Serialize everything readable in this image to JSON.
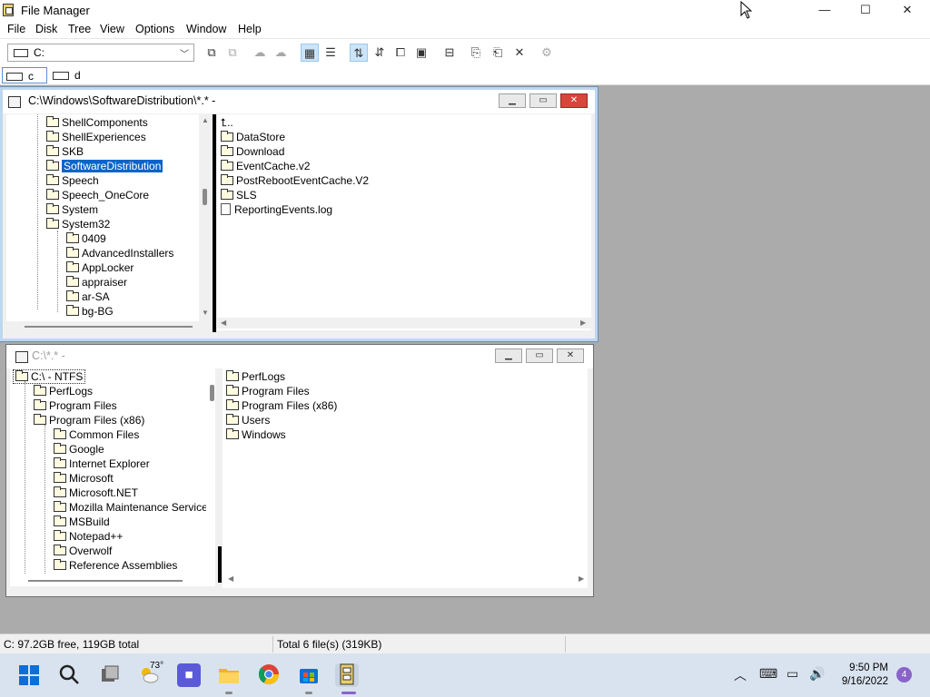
{
  "app": {
    "title": "File Manager",
    "controls": {
      "minimize": "—",
      "maximize": "☐",
      "close": "✕"
    }
  },
  "menu": [
    "File",
    "Disk",
    "Tree",
    "View",
    "Options",
    "Window",
    "Help"
  ],
  "toolbar": {
    "drive_selector": {
      "value": "C:"
    }
  },
  "drives": [
    {
      "label": "c",
      "selected": true
    },
    {
      "label": "d",
      "selected": false
    }
  ],
  "window1": {
    "title": "C:\\Windows\\SoftwareDistribution\\*.* -",
    "tree": [
      {
        "label": "ShellComponents",
        "level": 0
      },
      {
        "label": "ShellExperiences",
        "level": 0
      },
      {
        "label": "SKB",
        "level": 0
      },
      {
        "label": "SoftwareDistribution",
        "level": 0,
        "selected": true,
        "open": true
      },
      {
        "label": "Speech",
        "level": 0
      },
      {
        "label": "Speech_OneCore",
        "level": 0
      },
      {
        "label": "System",
        "level": 0
      },
      {
        "label": "System32",
        "level": 0
      },
      {
        "label": "0409",
        "level": 1
      },
      {
        "label": "AdvancedInstallers",
        "level": 1
      },
      {
        "label": "AppLocker",
        "level": 1
      },
      {
        "label": "appraiser",
        "level": 1
      },
      {
        "label": "ar-SA",
        "level": 1
      },
      {
        "label": "bg-BG",
        "level": 1
      }
    ],
    "up_label": "..",
    "files": [
      {
        "name": "DataStore",
        "type": "folder"
      },
      {
        "name": "Download",
        "type": "folder"
      },
      {
        "name": "EventCache.v2",
        "type": "folder"
      },
      {
        "name": "PostRebootEventCache.V2",
        "type": "folder"
      },
      {
        "name": "SLS",
        "type": "folder"
      },
      {
        "name": "ReportingEvents.log",
        "type": "file"
      }
    ]
  },
  "window2": {
    "title": "C:\\*.* -",
    "tree": [
      {
        "label": "C:\\ - NTFS",
        "level": 0,
        "root": true
      },
      {
        "label": "PerfLogs",
        "level": 1
      },
      {
        "label": "Program Files",
        "level": 1
      },
      {
        "label": "Program Files (x86)",
        "level": 1
      },
      {
        "label": "Common Files",
        "level": 2
      },
      {
        "label": "Google",
        "level": 2
      },
      {
        "label": "Internet Explorer",
        "level": 2
      },
      {
        "label": "Microsoft",
        "level": 2
      },
      {
        "label": "Microsoft.NET",
        "level": 2
      },
      {
        "label": "Mozilla Maintenance Service",
        "level": 2
      },
      {
        "label": "MSBuild",
        "level": 2
      },
      {
        "label": "Notepad++",
        "level": 2
      },
      {
        "label": "Overwolf",
        "level": 2
      },
      {
        "label": "Reference Assemblies",
        "level": 2
      }
    ],
    "files": [
      {
        "name": "PerfLogs",
        "type": "folder"
      },
      {
        "name": "Program Files",
        "type": "folder"
      },
      {
        "name": "Program Files (x86)",
        "type": "folder"
      },
      {
        "name": "Users",
        "type": "folder"
      },
      {
        "name": "Windows",
        "type": "folder"
      }
    ]
  },
  "status": {
    "disk": "C: 97.2GB free,  119GB total",
    "files": "Total 6 file(s) (319KB)"
  },
  "taskbar": {
    "weather_temp": "73°",
    "time": "9:50 PM",
    "date": "9/16/2022",
    "notification_count": "4"
  },
  "colors": {
    "selection": "#0a64c8",
    "mdi_background": "#ababab",
    "taskbar": "#d9e3ef",
    "close_red": "#d8453b"
  }
}
